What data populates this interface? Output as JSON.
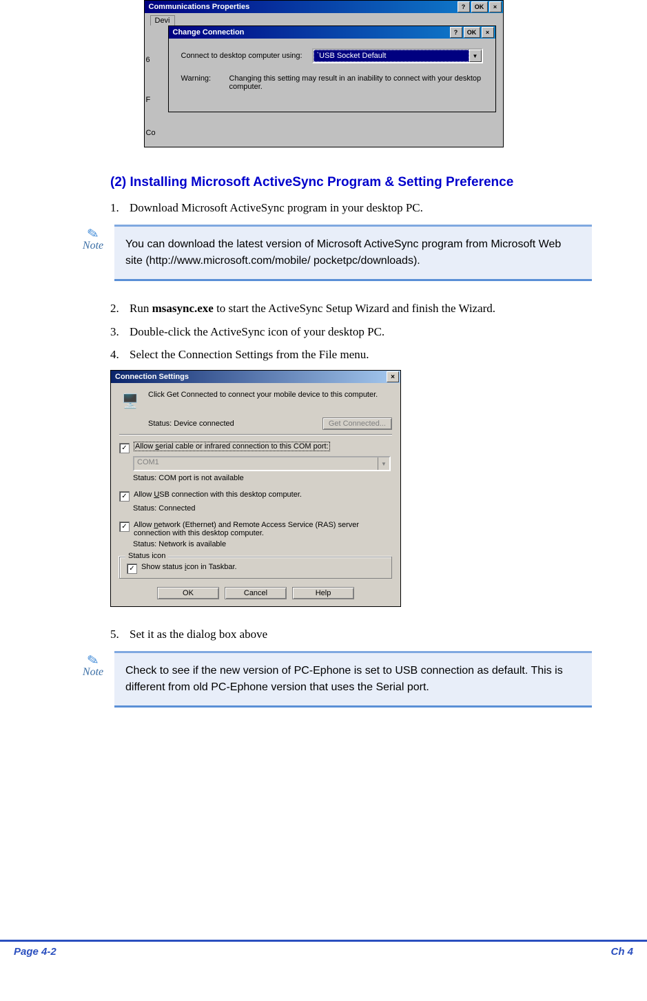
{
  "top_window": {
    "outer_title": "Communications Properties",
    "btn_help": "?",
    "btn_ok": "OK",
    "btn_close": "×",
    "tab_stub": "Devi",
    "side_stubs": [
      "6",
      "F",
      "Co"
    ],
    "inner_title": "Change Connection",
    "field_label": "Connect to desktop computer using:",
    "dropdown_value": "`USB Socket Default",
    "warning_label": "Warning:",
    "warning_text": "Changing this setting may result in an inability to connect with your desktop computer."
  },
  "section_heading": "(2)  Installing Microsoft ActiveSync Program & Setting Preference",
  "steps": {
    "s1_num": "1.",
    "s1_text": "Download Microsoft ActiveSync program in your desktop PC.",
    "s2_num": "2.",
    "s2_pre": "Run ",
    "s2_bold": "msasync.exe",
    "s2_post": " to start the ActiveSync Setup Wizard and finish the Wizard.",
    "s3_num": "3.",
    "s3_text": "Double-click the ActiveSync icon of your desktop PC.",
    "s4_num": "4.",
    "s4_text": "Select the Connection Settings from the File menu.",
    "s5_num": "5.",
    "s5_text": "Set it as the dialog box above"
  },
  "note1": {
    "label": "Note",
    "text": "You can download the latest version of Microsoft ActiveSync program from Microsoft Web site (http://www.microsoft.com/mobile/ pocketpc/downloads)."
  },
  "note2": {
    "label": "Note",
    "text": "Check to see if the new version of PC-Ephone is set to USB connection as default. This is different from old PC-Ephone version that uses the Serial port."
  },
  "cs": {
    "title": "Connection Settings",
    "close": "×",
    "intro": "Click Get Connected to connect your mobile device to this computer.",
    "status_label": "Status: Device connected",
    "get_connected": "Get Connected...",
    "opt1_pre": "Allow ",
    "opt1_u": "s",
    "opt1_post": "erial cable or infrared connection to this COM port:",
    "combo_val": "COM1",
    "opt1_status": "Status:    COM port is not available",
    "opt2_pre": "Allow ",
    "opt2_u": "U",
    "opt2_post": "SB connection with this desktop computer.",
    "opt2_status": "Status:    Connected",
    "opt3_pre": "Allow ",
    "opt3_u": "n",
    "opt3_post": "etwork (Ethernet) and Remote Access Service (RAS) server connection with this desktop computer.",
    "opt3_status": "Status:    Network is available",
    "group_label": "Status icon",
    "opt4_pre": "Show status ",
    "opt4_u": "i",
    "opt4_post": "con in Taskbar.",
    "btn_ok": "OK",
    "btn_cancel": "Cancel",
    "btn_help": "Help",
    "check": "✓"
  },
  "footer": {
    "left": "Page 4-2",
    "right": "Ch 4"
  }
}
